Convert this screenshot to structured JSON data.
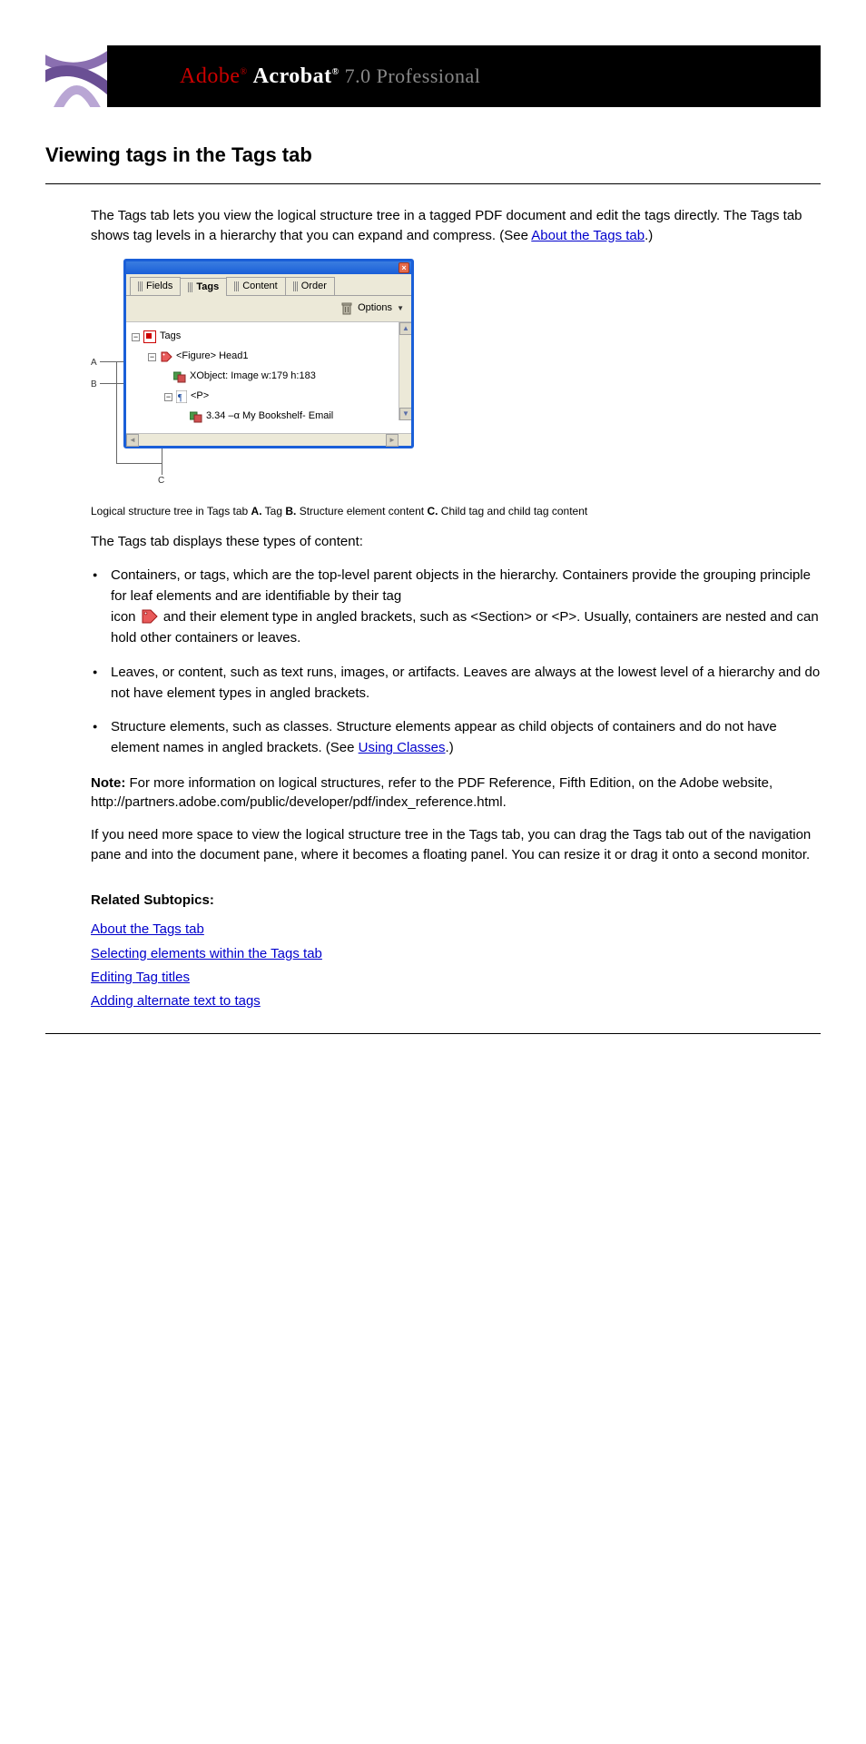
{
  "banner": {
    "brand": "Adobe",
    "product": "Acrobat",
    "version_suffix": "7.0 Professional"
  },
  "title": "Viewing tags in the Tags tab",
  "intro": {
    "p1_a": "The Tags tab lets you view the logical structure tree in a tagged PDF document and edit the tags directly. The Tags tab shows tag levels in a hierarchy that you can expand and compress. (See ",
    "p1_link": "About the Tags tab",
    "p1_b": ".)"
  },
  "panel": {
    "tabs": [
      "Fields",
      "Tags",
      "Content",
      "Order"
    ],
    "active_tab": "Tags",
    "options_label": "Options",
    "tree": {
      "root": "Tags",
      "figure": "<Figure> Head1",
      "xobject": "XObject:  Image  w:179 h:183",
      "p": "<P>",
      "leaf": "3.34 –α My Bookshelf- Email"
    }
  },
  "callouts": {
    "a": "A",
    "b": "B",
    "c": "C"
  },
  "caption": {
    "lead": "Logical structure tree in Tags tab ",
    "a_key": "A.",
    "a_val": " Tag ",
    "b_key": "B.",
    "b_val": " Structure element content ",
    "c_key": "C.",
    "c_val": " Child tag and child tag content"
  },
  "defs_intro": "The Tags tab displays these types of content:",
  "defs": {
    "containers_a": "Containers, or tags, which are the top-level parent objects in the hierarchy. Containers provide the grouping principle for leaf elements and are identifiable by their tag",
    "containers_b": "icon ",
    "containers_c": " and their element type in angled brackets, such as <Section> or <P>. Usually, containers are nested and can hold other containers or leaves.",
    "leaves": "Leaves, or content, such as text runs, images, or artifacts. Leaves are always at the lowest level of a hierarchy and do not have element types in angled brackets.",
    "structure_a": "Structure elements, such as classes. Structure elements appear as child objects of containers and do not have element names in angled brackets. (See ",
    "structure_link": "Using Classes",
    "structure_b": ".)"
  },
  "note": {
    "label": "Note:",
    "text": " For more information on logical structures, refer to the PDF Reference, Fifth Edition, on the Adobe website, http://partners.adobe.com/public/developer/pdf/index_reference.html."
  },
  "tip": "If you need more space to view the logical structure tree in the Tags tab, you can drag the Tags tab out of the navigation pane and into the document pane, where it becomes a floating panel. You can resize it or drag it onto a second monitor.",
  "related_head": "Related Subtopics:",
  "related": [
    "About the Tags tab",
    "Selecting elements within the Tags tab",
    "Editing Tag titles",
    "Adding alternate text to tags"
  ]
}
